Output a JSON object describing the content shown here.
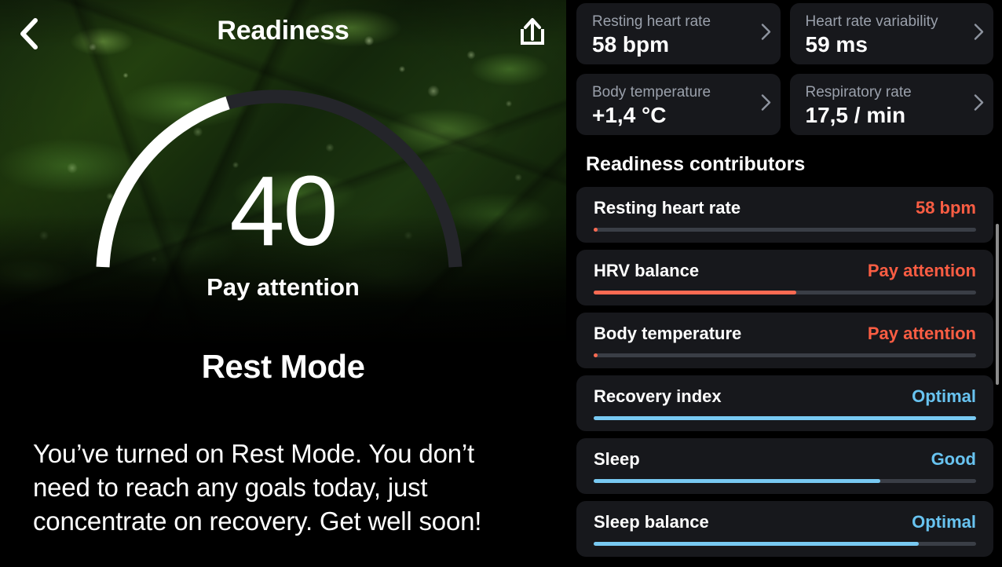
{
  "header": {
    "title": "Readiness",
    "back_icon": "chevron-left-icon",
    "share_icon": "share-upload-icon"
  },
  "gauge": {
    "score": "40",
    "state": "Pay attention",
    "score_value": 40,
    "max": 100,
    "fill_color": "#ffffff",
    "track_color": "#24252a"
  },
  "rest_mode": {
    "title": "Rest Mode",
    "body": "You’ve turned on Rest Mode. You don’t need to reach any goals today, just concentrate on recovery. Get well soon!"
  },
  "metrics": [
    {
      "label": "Resting heart rate",
      "value": "58 bpm",
      "chevron": "chevron-right-icon"
    },
    {
      "label": "Heart rate variability",
      "value": "59 ms",
      "chevron": "chevron-right-icon"
    },
    {
      "label": "Body temperature",
      "value": "+1,4 °C",
      "chevron": "chevron-right-icon"
    },
    {
      "label": "Respiratory rate",
      "value": "17,5 / min",
      "chevron": "chevron-right-icon"
    }
  ],
  "contributors": {
    "title": "Readiness contributors",
    "items": [
      {
        "name": "Resting heart rate",
        "value": "58 bpm",
        "tone": "red",
        "percent": 1
      },
      {
        "name": "HRV balance",
        "value": "Pay attention",
        "tone": "red",
        "percent": 53
      },
      {
        "name": "Body temperature",
        "value": "Pay attention",
        "tone": "red",
        "percent": 1
      },
      {
        "name": "Recovery index",
        "value": "Optimal",
        "tone": "blue",
        "percent": 100
      },
      {
        "name": "Sleep",
        "value": "Good",
        "tone": "blue",
        "percent": 75
      },
      {
        "name": "Sleep balance",
        "value": "Optimal",
        "tone": "blue",
        "percent": 85
      }
    ]
  },
  "colors": {
    "background": "#000000",
    "card": "#17181c",
    "accent_red": "#fb5d43",
    "accent_blue": "#68c3f0",
    "muted_text": "#9aa0ab",
    "track": "#3a3e46"
  }
}
